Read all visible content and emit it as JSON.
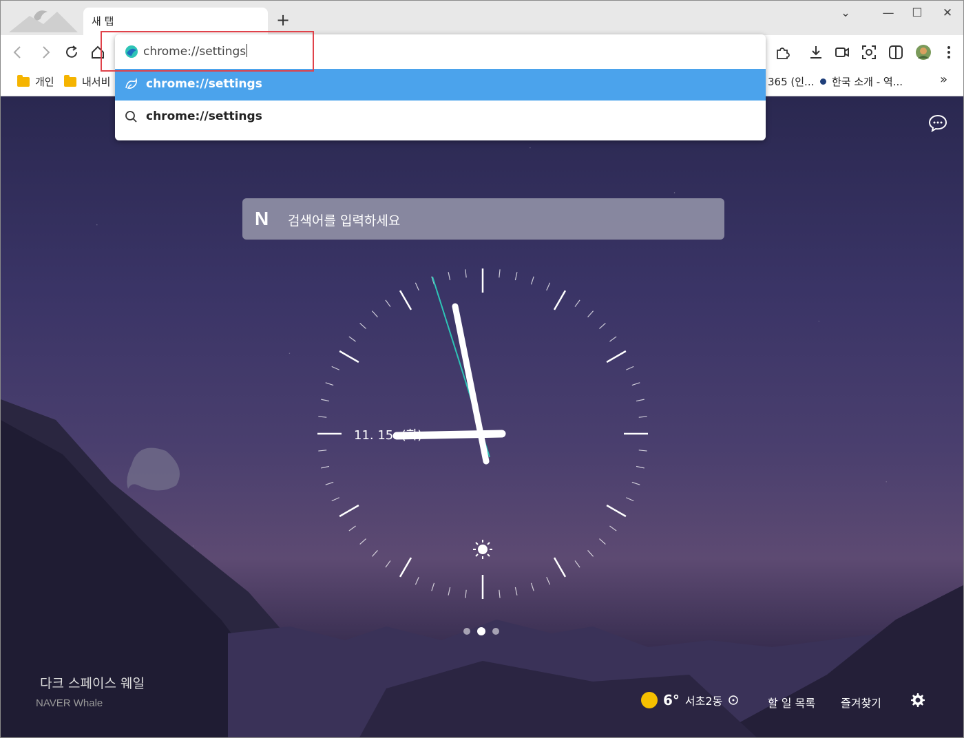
{
  "tab": {
    "title": "새 탭",
    "new_tab": "+"
  },
  "window_controls": {
    "list": "⌄",
    "minimize": "—",
    "maximize": "☐",
    "close": "✕"
  },
  "bookmarks": {
    "items": [
      {
        "label": "개인"
      },
      {
        "label": "내서비"
      },
      {
        "label": "365 (인..."
      },
      {
        "label": "한국 소개 - 역..."
      }
    ],
    "more": "»"
  },
  "omnibox": {
    "value": "chrome://settings",
    "suggestions": [
      {
        "text": "chrome://settings",
        "selected": true
      },
      {
        "text": "chrome://settings",
        "selected": false
      }
    ]
  },
  "newtab": {
    "search_placeholder": "검색어를 입력하세요",
    "search_logo": "N",
    "clock_date": "11. 15. (화)",
    "pager": {
      "count": 3,
      "active": 2
    },
    "theme_name": "다크 스페이스 웨일",
    "theme_brand": "NAVER Whale",
    "weather": {
      "temp": "6°",
      "location": "서초2동"
    },
    "links": {
      "todo": "할 일 목록",
      "favorites": "즐겨찾기"
    }
  },
  "colors": {
    "accent": "#4ba3ec",
    "highlight": "#e0424a",
    "sun": "#f6c000"
  }
}
